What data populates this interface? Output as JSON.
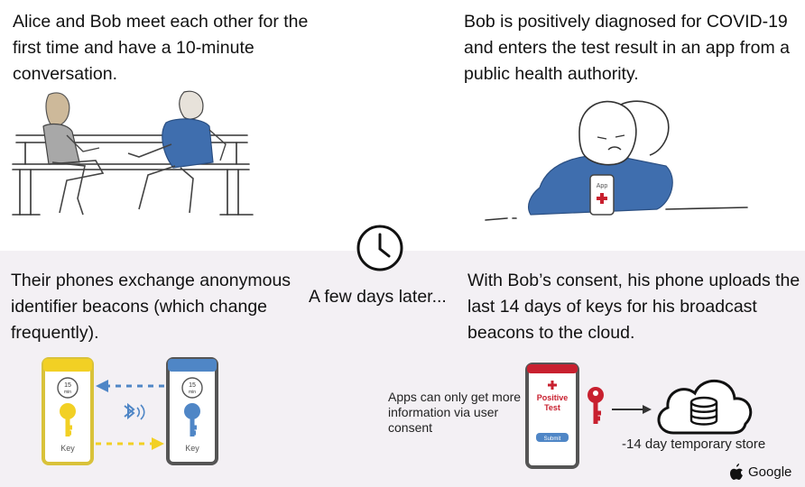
{
  "panel_alice_bob": "Alice and Bob meet each other for the first time and have a 10-minute conversation.",
  "panel_bob_diagnosed": "Bob is positively diagnosed for COVID-19 and enters the test result in an app from a public health authority.",
  "panel_exchange": "Their phones exchange anonymous identifier beacons (which change frequently).",
  "middle_text": "A few days later...",
  "panel_upload": "With Bob’s consent, his phone uploads the last 14 days of keys for his broadcast beacons to the cloud.",
  "consent_note": "Apps can only get more information via user consent",
  "store_label": "-14 day temporary store",
  "phone_left": {
    "timer": "15",
    "timer_unit": "min",
    "key_label": "Key"
  },
  "phone_right": {
    "timer": "15",
    "timer_unit": "min",
    "key_label": "Key"
  },
  "bob_phone_app": "App",
  "positive_test": {
    "line1": "Positive",
    "line2": "Test",
    "button": "Submit"
  },
  "brand_google": "Google",
  "colors": {
    "yellow": "#f2d024",
    "blue": "#4f86c6",
    "red": "#c8202f",
    "bg_bottom": "#f3f0f4",
    "shirt_blue": "#3f6eae"
  }
}
